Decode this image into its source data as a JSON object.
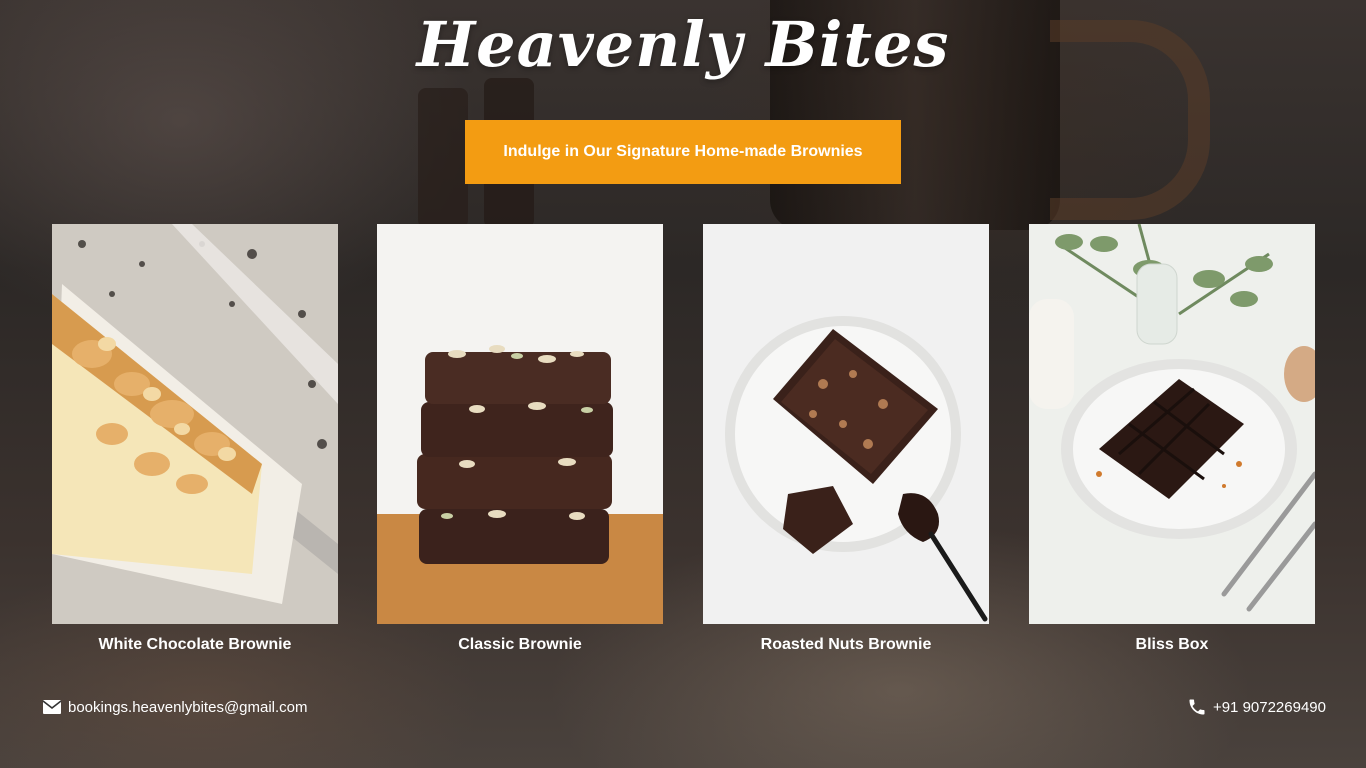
{
  "site": {
    "title": "Heavenly Bites",
    "cta_label": "Indulge in Our Signature Home-made Brownies",
    "accent_color": "#f39c12"
  },
  "products": [
    {
      "name": "White Chocolate Brownie",
      "image": "white-chocolate-brownie-photo"
    },
    {
      "name": "Classic Brownie",
      "image": "classic-brownie-stack-photo"
    },
    {
      "name": "Roasted Nuts Brownie",
      "image": "roasted-nuts-brownie-photo"
    },
    {
      "name": "Bliss Box",
      "image": "bliss-box-brownie-photo"
    }
  ],
  "footer": {
    "email": "bookings.heavenlybites@gmail.com",
    "email_icon": "mail-icon",
    "phone": "+91 9072269490",
    "phone_icon": "phone-icon"
  }
}
